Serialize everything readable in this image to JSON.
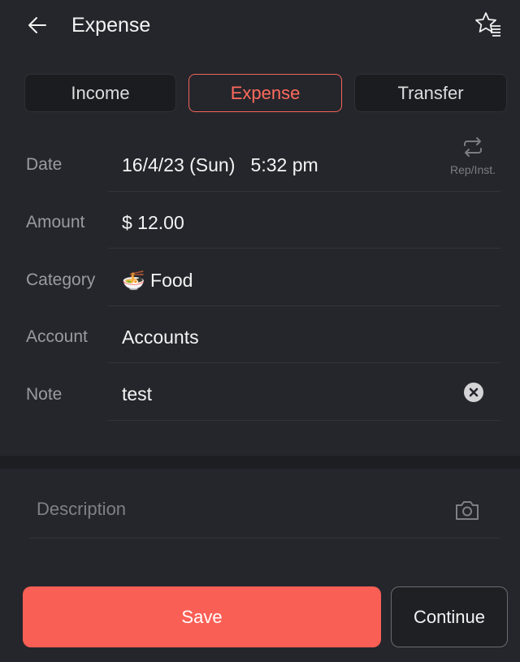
{
  "header": {
    "title": "Expense",
    "back_icon": "arrow-left-icon",
    "favorites_icon": "star-list-icon"
  },
  "tabs": [
    {
      "label": "Income",
      "active": false
    },
    {
      "label": "Expense",
      "active": true
    },
    {
      "label": "Transfer",
      "active": false
    }
  ],
  "form": {
    "date": {
      "label": "Date",
      "value": "16/4/23 (Sun)   5:32 pm"
    },
    "repeat": {
      "label": "Rep/Inst.",
      "icon": "repeat-icon"
    },
    "amount": {
      "label": "Amount",
      "value": "$ 12.00"
    },
    "category": {
      "label": "Category",
      "emoji": "🍜",
      "value": "Food"
    },
    "account": {
      "label": "Account",
      "value": "Accounts"
    },
    "note": {
      "label": "Note",
      "value": "test",
      "clear_icon": "clear-circle-icon"
    }
  },
  "description": {
    "placeholder": "Description",
    "camera_icon": "camera-icon"
  },
  "actions": {
    "save": "Save",
    "continue": "Continue"
  },
  "colors": {
    "accent": "#fa5f55",
    "background": "#25262c"
  }
}
